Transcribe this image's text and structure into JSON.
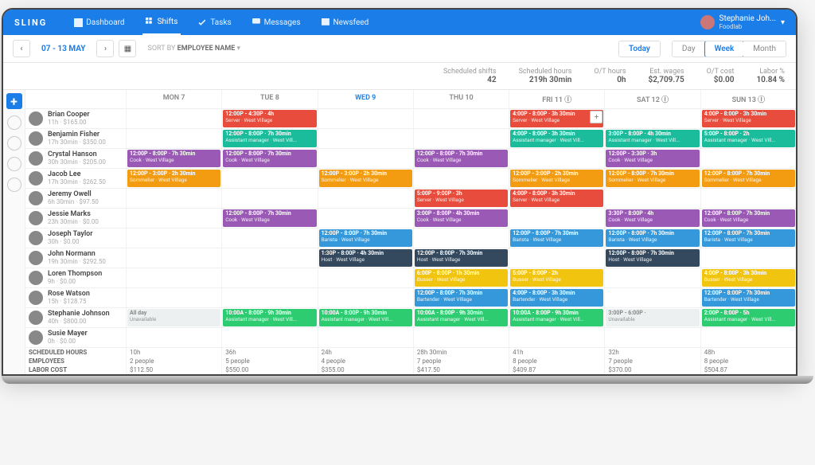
{
  "brand": "SLING",
  "nav": {
    "dashboard": "Dashboard",
    "shifts": "Shifts",
    "tasks": "Tasks",
    "messages": "Messages",
    "newsfeed": "Newsfeed"
  },
  "user": {
    "name": "Stephanie Joh...",
    "org": "Foodlab"
  },
  "dateRange": "07 - 13 MAY",
  "sortBy": {
    "label": "SORT BY",
    "value": "EMPLOYEE NAME"
  },
  "views": {
    "today": "Today",
    "day": "Day",
    "week": "Week",
    "month": "Month"
  },
  "stats": {
    "shifts": {
      "label": "Scheduled shifts",
      "value": "42"
    },
    "hours": {
      "label": "Scheduled hours",
      "value": "219h 30min"
    },
    "ot": {
      "label": "O/T hours",
      "value": "0h"
    },
    "wages": {
      "label": "Est. wages",
      "value": "$2,709.75"
    },
    "otcost": {
      "label": "O/T cost",
      "value": "$0.00"
    },
    "labor": {
      "label": "Labor %",
      "value": "10.84 %"
    }
  },
  "days": [
    "MON 7",
    "TUE 8",
    "WED 9",
    "THU 10",
    "FRI 11",
    "SAT 12",
    "SUN 13"
  ],
  "employees": [
    {
      "name": "Brian Cooper",
      "meta": "11h · $165.00"
    },
    {
      "name": "Benjamin Fisher",
      "meta": "17h 30min · $350.00"
    },
    {
      "name": "Crystal Hanson",
      "meta": "30h 30min · $205.00"
    },
    {
      "name": "Jacob Lee",
      "meta": "17h 30min · $262.50"
    },
    {
      "name": "Jeremy Owell",
      "meta": "6h 30min · $97.50"
    },
    {
      "name": "Jessie Marks",
      "meta": "23h 30min · $0.00"
    },
    {
      "name": "Joseph Taylor",
      "meta": "30h · $0.00"
    },
    {
      "name": "John Normann",
      "meta": "19h 30min · $292.50"
    },
    {
      "name": "Loren Thompson",
      "meta": "9h · $0.00"
    },
    {
      "name": "Rose Watson",
      "meta": "15h · $128.75"
    },
    {
      "name": "Stephanie Johnson",
      "meta": "40h · $800.00"
    },
    {
      "name": "Susie Mayer",
      "meta": "0h · $0.00"
    }
  ],
  "shifts": {
    "0": {
      "1": {
        "c": "red",
        "t": "12:00P - 4:30P · 4h",
        "r": "Server · West Village"
      },
      "4": {
        "c": "red",
        "t": "4:00P - 8:00P · 3h 30min",
        "r": "Server · West Village",
        "add": true
      },
      "6": {
        "c": "red",
        "t": "4:00P - 8:00P · 3h 30min",
        "r": "Server · West Village"
      }
    },
    "1": {
      "1": {
        "c": "teal",
        "t": "12:00P - 8:00P · 7h 30min",
        "r": "Assistant manager · West Vill..."
      },
      "4": {
        "c": "teal",
        "t": "4:00P - 8:00P · 3h 30min",
        "r": "Assistant manager · West Vill..."
      },
      "5": {
        "c": "teal",
        "t": "3:00P - 8:00P · 4h 30min",
        "r": "Assistant manager · West Vill..."
      },
      "6": {
        "c": "teal",
        "t": "5:00P - 8:00P · 2h",
        "r": "Assistant manager · West Vill..."
      }
    },
    "2": {
      "0": {
        "c": "purple",
        "t": "12:00P - 8:00P · 7h 30min",
        "r": "Cook · West Village"
      },
      "1": {
        "c": "purple",
        "t": "12:00P - 8:00P · 7h 30min",
        "r": "Cook · West Village"
      },
      "3": {
        "c": "purple",
        "t": "12:00P - 8:00P · 7h 30min",
        "r": "Cook · West Village"
      },
      "5": {
        "c": "purple",
        "t": "12:00P - 3:30P · 3h",
        "r": "Cook · West Village"
      }
    },
    "3": {
      "0": {
        "c": "orange",
        "t": "12:00P - 3:00P · 2h 30min",
        "r": "Sommelier · West Village"
      },
      "2": {
        "c": "orange",
        "t": "12:00P - 3:00P · 2h 30min",
        "r": "Sommelier · West Village"
      },
      "4": {
        "c": "orange",
        "t": "12:00P - 3:00P · 2h 30min",
        "r": "Sommelier · West Village"
      },
      "5": {
        "c": "orange",
        "t": "12:00P - 8:00P · 7h 30min",
        "r": "Sommelier · West Village"
      },
      "6": {
        "c": "orange",
        "t": "12:00P - 8:00P · 7h 30min",
        "r": "Sommelier · West Village"
      }
    },
    "4": {
      "3": {
        "c": "red",
        "t": "5:00P - 9:00P · 3h",
        "r": "Server · West Village"
      },
      "4": {
        "c": "red",
        "t": "4:00P - 8:00P · 3h 30min",
        "r": "Server · West Village"
      }
    },
    "5": {
      "1": {
        "c": "purple",
        "t": "12:00P - 8:00P · 7h 30min",
        "r": "Cook · West Village"
      },
      "3": {
        "c": "purple",
        "t": "3:00P - 8:00P · 4h 30min",
        "r": "Cook · West Village"
      },
      "5": {
        "c": "purple",
        "t": "3:30P - 8:00P · 4h",
        "r": "Cook · West Village"
      },
      "6": {
        "c": "purple",
        "t": "12:00P - 8:00P · 7h 30min",
        "r": "Cook · West Village"
      }
    },
    "6": {
      "2": {
        "c": "blue",
        "t": "12:00P - 8:00P · 7h 30min",
        "r": "Barista · West Village"
      },
      "4": {
        "c": "blue",
        "t": "12:00P - 8:00P · 7h 30min",
        "r": "Barista · West Village"
      },
      "5": {
        "c": "blue",
        "t": "12:00P - 8:00P · 7h 30min",
        "r": "Barista · West Village"
      },
      "6": {
        "c": "blue",
        "t": "12:00P - 8:00P · 7h 30min",
        "r": "Barista · West Village"
      }
    },
    "7": {
      "2": {
        "c": "navy",
        "t": "1:30P - 8:00P · 4h 30min",
        "r": "Host · West Village"
      },
      "3": {
        "c": "navy",
        "t": "12:00P - 8:00P · 7h 30min",
        "r": "Host · West Village"
      },
      "5": {
        "c": "navy",
        "t": "12:00P - 8:00P · 7h 30min",
        "r": "Host · West Village"
      }
    },
    "8": {
      "3": {
        "c": "yellow",
        "t": "6:00P - 8:00P · 1h 30min",
        "r": "Busser · West Village"
      },
      "4": {
        "c": "yellow",
        "t": "5:00P - 8:00P · 2h",
        "r": "Busser · West Village"
      },
      "6": {
        "c": "yellow",
        "t": "4:00P - 8:00P · 3h 30min",
        "r": "Busser · West Village"
      }
    },
    "9": {
      "3": {
        "c": "blue",
        "t": "12:00P - 8:00P · 7h 30min",
        "r": "Bartender · West Village"
      },
      "4": {
        "c": "blue",
        "t": "4:00P - 8:00P · 3h 30min",
        "r": "Bartender · West Village"
      },
      "6": {
        "c": "blue",
        "t": "12:00P - 8:00P · 7h 30min",
        "r": "Bartender · West Village"
      }
    },
    "10": {
      "0": {
        "c": "grey",
        "t": "All day",
        "r": "Unavailable"
      },
      "1": {
        "c": "green",
        "t": "10:00A - 8:00P · 9h 30min",
        "r": "Assistant manager · West Vill..."
      },
      "2": {
        "c": "green",
        "t": "10:00A - 8:00P · 9h 30min",
        "r": "Assistant manager · West Vill..."
      },
      "3": {
        "c": "green",
        "t": "10:00A - 8:00P · 9h 30min",
        "r": "Assistant manager · West Vill..."
      },
      "4": {
        "c": "green",
        "t": "10:00A - 8:00P · 9h 30min",
        "r": "Assistant manager · West Vill..."
      },
      "5": {
        "c": "grey",
        "t": "3:00P - 6:00P ·",
        "r": "Unavailable"
      },
      "6": {
        "c": "green",
        "t": "2:00P - 8:00P · 5h",
        "r": "Assistant manager · West Vill..."
      }
    }
  },
  "footer": {
    "rows": [
      {
        "label": "SCHEDULED HOURS",
        "vals": [
          "10h",
          "36h",
          "24h",
          "28h 30min",
          "41h",
          "32h",
          "48h"
        ]
      },
      {
        "label": "EMPLOYEES",
        "vals": [
          "2 people",
          "5 people",
          "4 people",
          "7 people",
          "8 people",
          "7 people",
          "8 people"
        ]
      },
      {
        "label": "LABOR COST",
        "vals": [
          "$112.50",
          "$550.00",
          "$355.00",
          "$417.50",
          "$409.87",
          "$370.00",
          "$504.87"
        ]
      }
    ]
  }
}
